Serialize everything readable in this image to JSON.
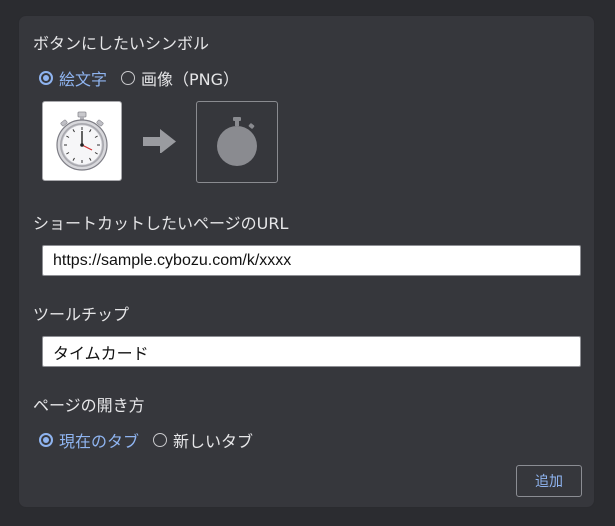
{
  "symbol_section": {
    "title": "ボタンにしたいシンボル",
    "options": [
      {
        "label": "絵文字",
        "selected": true
      },
      {
        "label": "画像（PNG）",
        "selected": false
      }
    ],
    "source_icon": "stopwatch-emoji-icon",
    "arrow_icon": "right-arrow-icon",
    "result_icon": "stopwatch-silhouette-icon"
  },
  "url_section": {
    "title": "ショートカットしたいページのURL",
    "value": "https://sample.cybozu.com/k/xxxx"
  },
  "tooltip_section": {
    "title": "ツールチップ",
    "value": "タイムカード"
  },
  "open_section": {
    "title": "ページの開き方",
    "options": [
      {
        "label": "現在のタブ",
        "selected": true
      },
      {
        "label": "新しいタブ",
        "selected": false
      }
    ]
  },
  "actions": {
    "add_label": "追加"
  },
  "colors": {
    "panel_bg": "#36373c",
    "page_bg": "#2b2c30",
    "accent": "#8fb4f0",
    "text": "#e6e6e8"
  }
}
